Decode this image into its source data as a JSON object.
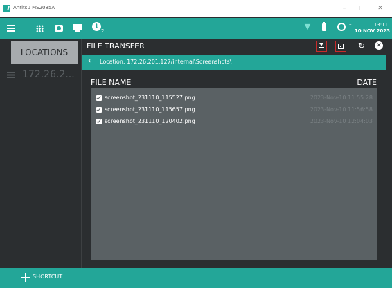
{
  "window": {
    "title": "Anritsu MS2085A",
    "minimize": "–",
    "maximize": "□",
    "close": "✕"
  },
  "toolbar": {
    "info_count": "2",
    "time": "13:11",
    "date": "10 NOV 2023",
    "icons": [
      "menu-icon",
      "apps-grid-icon",
      "camera-icon",
      "monitor-icon",
      "info-icon",
      "wifi-icon",
      "battery-icon",
      "gps-icon"
    ]
  },
  "sidebar": {
    "locations_label": "LOCATIONS",
    "items": [
      {
        "label": "172.26.2..."
      }
    ]
  },
  "panel": {
    "title": "FILE TRANSFER",
    "location": "Location: 172.26.201.127/internal\\Screenshots\\",
    "columns": {
      "name": "FILE NAME",
      "date": "DATE"
    },
    "files": [
      {
        "name": "screenshot_231110_115527.png",
        "date": "2023-Nov-10 11:55:28",
        "checked": true
      },
      {
        "name": "screenshot_231110_115657.png",
        "date": "2023-Nov-10 11:56:58",
        "checked": true
      },
      {
        "name": "screenshot_231110_120402.png",
        "date": "2023-Nov-10 12:04:03",
        "checked": true
      }
    ],
    "highlight_color": "#c82a2a"
  },
  "bottom": {
    "shortcut_label": "SHORTCUT"
  },
  "colors": {
    "accent": "#23a698",
    "dark_bg": "#2b2e30",
    "list_bg": "#5a6164"
  }
}
